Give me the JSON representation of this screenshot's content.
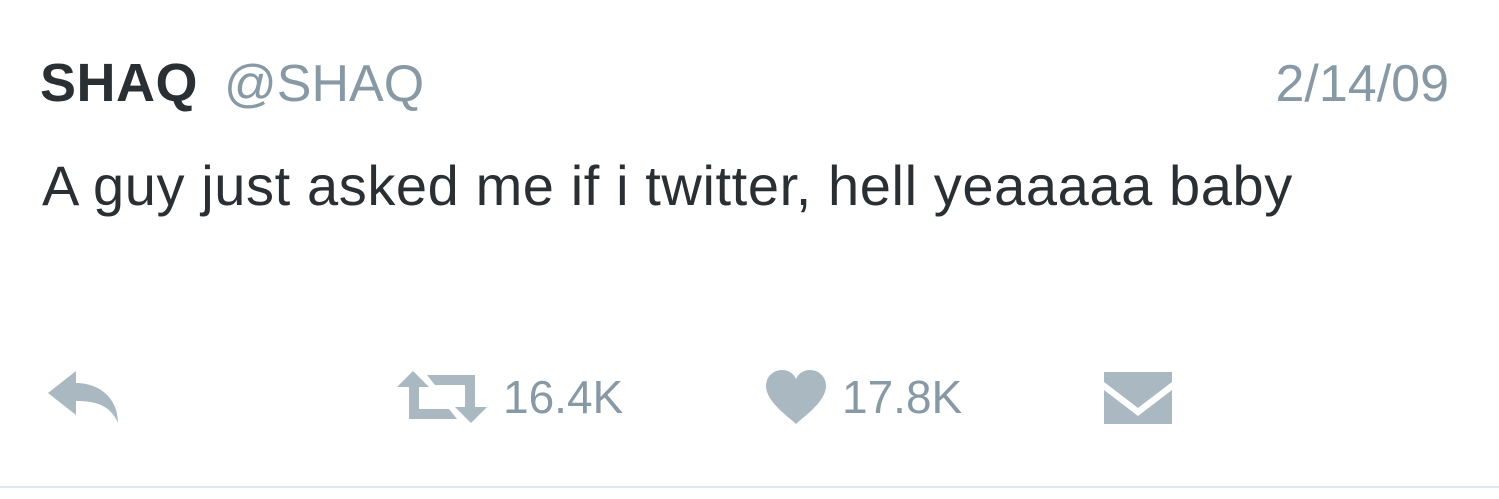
{
  "tweet": {
    "display_name": "SHAQ",
    "handle": "@SHAQ",
    "date": "2/14/09",
    "text": "A guy just asked me if i twitter, hell yeaaaaa baby"
  },
  "actions": {
    "reply_icon": "reply-arrow-icon",
    "retweet_icon": "retweet-icon",
    "retweet_count": "16.4K",
    "like_icon": "heart-icon",
    "like_count": "17.8K",
    "dm_icon": "envelope-icon"
  },
  "colors": {
    "text": "#292f33",
    "muted": "#8899a6",
    "icon": "#aab8c2",
    "divider": "#e1e8ed"
  }
}
